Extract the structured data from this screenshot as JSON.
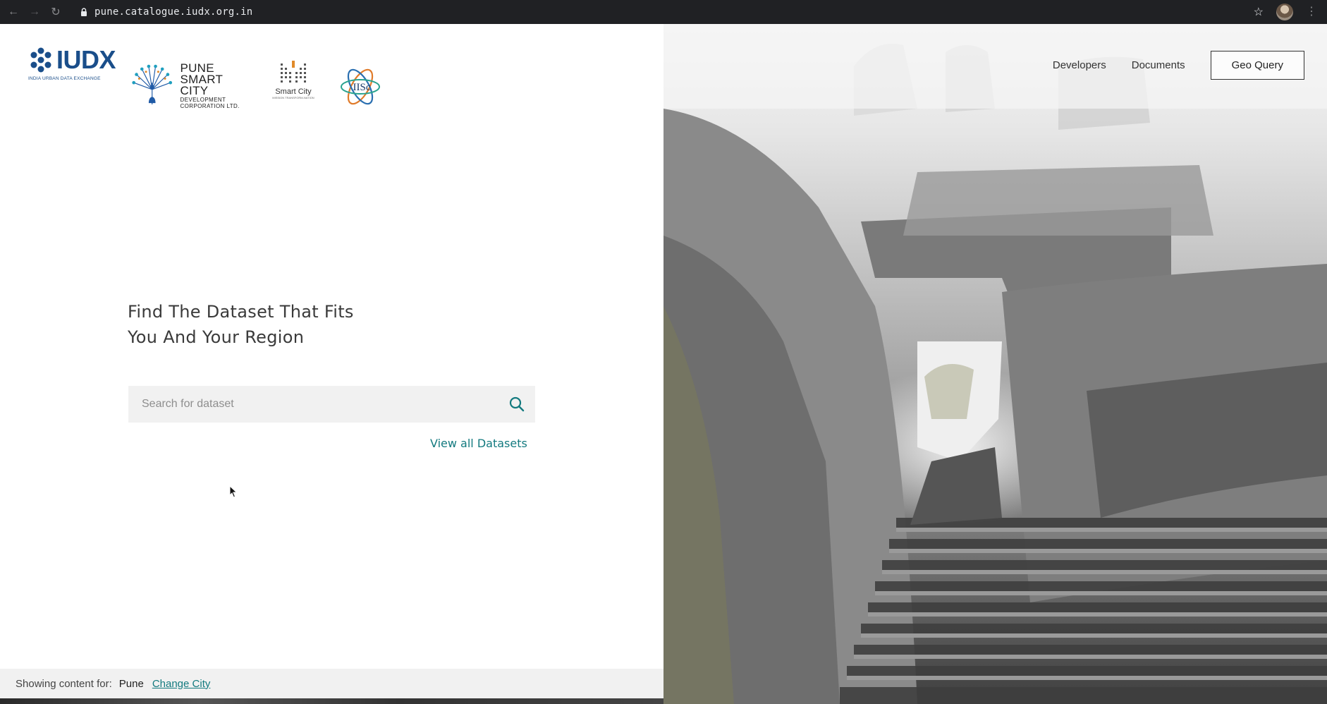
{
  "browser": {
    "url": "pune.catalogue.iudx.org.in"
  },
  "header": {
    "logos": {
      "iudx": {
        "word": "IUDX",
        "tagline": "INDIA URBAN DATA EXCHANGE"
      },
      "pune": {
        "line1": "PUNE",
        "line2": "SMART CITY",
        "line3": "DEVELOPMENT",
        "line4": "CORPORATION LTD."
      },
      "smart_city": {
        "label": "Smart City",
        "tagline": "MISSION TRANSFORM-NATION"
      },
      "iisc": {
        "label": "IISc"
      }
    },
    "nav": {
      "developers": "Developers",
      "documents": "Documents",
      "geo_query": "Geo Query"
    }
  },
  "hero": {
    "title_line1": "Find The Dataset That Fits",
    "title_line2": "You And Your Region",
    "search_placeholder": "Search for dataset",
    "view_all": "View all Datasets"
  },
  "footer": {
    "showing_label": "Showing content for:",
    "city": "Pune",
    "change_city": "Change City"
  },
  "colors": {
    "accent": "#137a7f",
    "brand_blue": "#1a4e8a",
    "chrome_bg": "#202124"
  }
}
